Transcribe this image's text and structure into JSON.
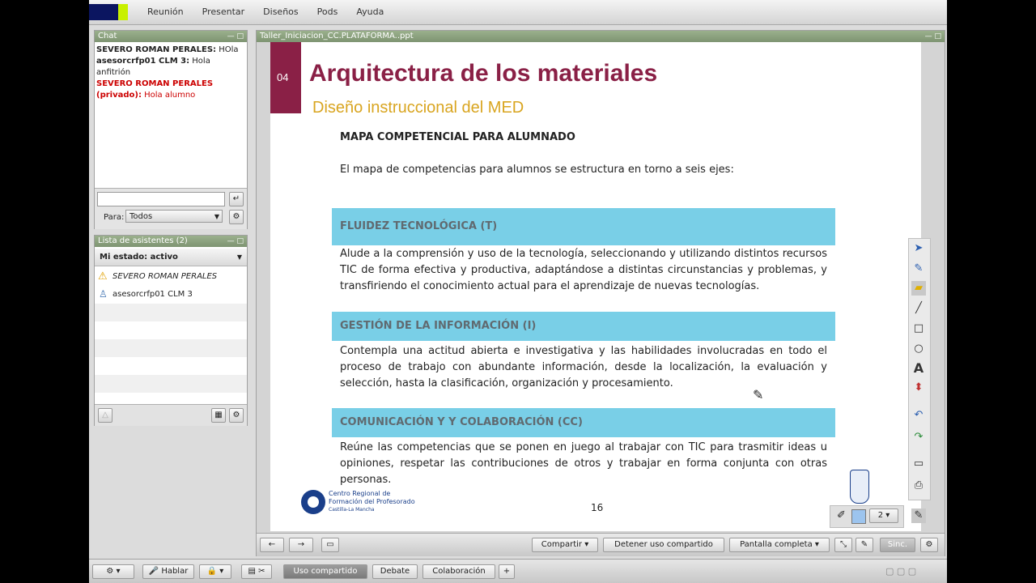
{
  "menu": [
    "Reunión",
    "Presentar",
    "Diseños",
    "Pods",
    "Ayuda"
  ],
  "chat": {
    "title": "Chat",
    "messages": [
      {
        "sender": "SEVERO ROMAN PERALES:",
        "text": " HOla",
        "color": "#000000"
      },
      {
        "sender": "asesorcrfp01 CLM 3:",
        "text": " Hola anfitrión",
        "color": "#000000"
      },
      {
        "sender": "SEVERO ROMAN PERALES (privado):",
        "text": " Hola alumno",
        "color": "#cc0000"
      }
    ],
    "to_label": "Para:",
    "to_value": "Todos"
  },
  "attendees": {
    "title": "Lista de asistentes (2)",
    "status": "Mi estado: activo",
    "list": [
      "SEVERO ROMAN PERALES",
      "asesorcrfp01 CLM 3"
    ]
  },
  "share": {
    "title": "Taller_Iniciacion_CC.PLATAFORMA..ppt",
    "slide": {
      "number_tag": "04",
      "heading": "Arquitectura de los materiales",
      "subheading": "Diseño instruccional del MED",
      "section_title": "MAPA COMPETENCIAL PARA ALUMNADO",
      "intro": "El mapa de competencias para alumnos se estructura en torno a seis ejes:",
      "blocks": [
        {
          "title": "FLUIDEZ TECNOLÓGICA (T)",
          "text": "Alude a la comprensión y uso de la tecnología, seleccionando y utilizando distintos recursos TIC de forma efectiva y productiva, adaptándose a distintas circunstancias y problemas, y transfiriendo el conocimiento actual para el aprendizaje de nuevas tecnologías."
        },
        {
          "title": "GESTIÓN DE LA INFORMACIÓN (I)",
          "text": "Contempla una actitud abierta e investigativa y las habilidades involucradas en todo el proceso de trabajo con abundante información, desde la localización, la evaluación y selección, hasta la clasificación, organización y procesamiento."
        },
        {
          "title": "COMUNICACIÓN Y Y COLABORACIÓN (CC)",
          "text": "Reúne las competencias que se ponen en juego al trabajar con TIC para trasmitir ideas u opiniones, respetar las contribuciones de otros y trabajar en forma conjunta con otras personas."
        }
      ],
      "footer_logo_line1": "Centro Regional de",
      "footer_logo_line2": "Formación del Profesorado",
      "footer_logo_line3": "Castilla-La Mancha",
      "page_number": "16"
    },
    "page_select": "2",
    "buttons": {
      "share": "Compartir",
      "stop": "Detener uso compartido",
      "fullscreen": "Pantalla completa",
      "sync": "Sinc."
    }
  },
  "bottom": {
    "talk": "Hablar",
    "tabs": [
      "Uso compartido",
      "Debate",
      "Colaboración"
    ],
    "add": "+"
  },
  "colors": {
    "accent_bar": "#79cfe7",
    "slide_heading": "#8a2046",
    "slide_sub": "#d9a520"
  }
}
